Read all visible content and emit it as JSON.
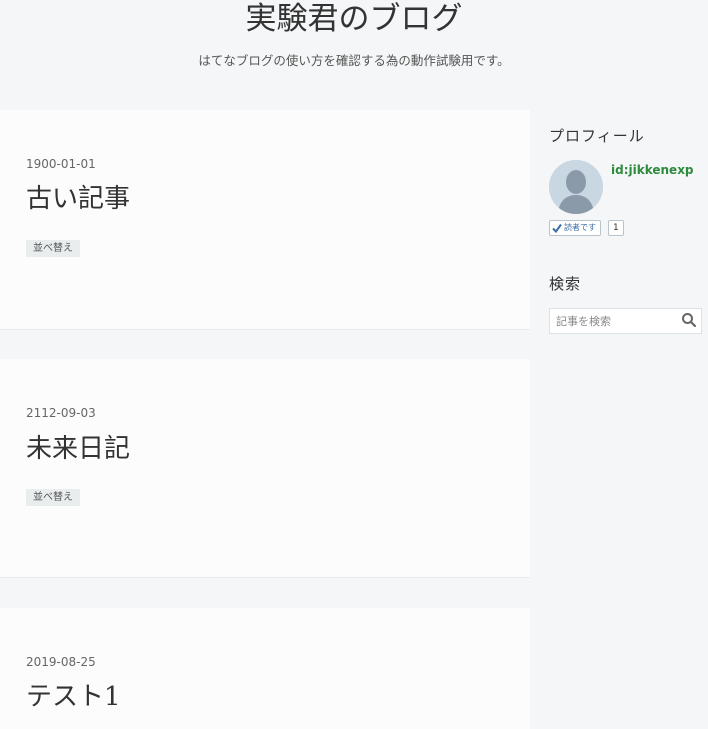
{
  "header": {
    "title": "実験君のブログ",
    "description": "はてなブログの使い方を確認する為の動作試験用です。"
  },
  "entries": [
    {
      "date": "1900-01-01",
      "title": "古い記事",
      "category": "並べ替え"
    },
    {
      "date": "2112-09-03",
      "title": "未来日記",
      "category": "並べ替え"
    },
    {
      "date": "2019-08-25",
      "title": "テスト1"
    }
  ],
  "sidebar": {
    "profile": {
      "heading": "プロフィール",
      "user_id": "id:jikkenexp",
      "reader_button": "読者です",
      "reader_count": "1"
    },
    "search": {
      "heading": "検索",
      "placeholder": "記事を検索"
    }
  },
  "colors": {
    "background": "#f4f6f7",
    "card": "#fcfcfc",
    "user_link": "#2e8b3e",
    "tag_bg": "#e9edee"
  },
  "icons": {
    "avatar": "default-user-avatar",
    "reader": "check-icon",
    "search": "search-icon"
  }
}
